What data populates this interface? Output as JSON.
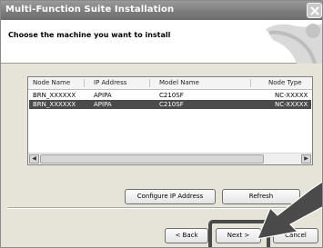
{
  "window": {
    "title": "Multi-Function Suite Installation"
  },
  "header": {
    "instruction": "Choose the machine you want to install"
  },
  "table": {
    "columns": [
      "Node Name",
      "IP Address",
      "Model Name",
      "Node Type"
    ],
    "rows": [
      {
        "node_name": "BRN_XXXXXX",
        "ip_address": "APIPA",
        "model_name": "C210SF",
        "node_type": "NC-XXXXX",
        "selected": false
      },
      {
        "node_name": "BRN_XXXXXX",
        "ip_address": "APIPA",
        "model_name": "C210SF",
        "node_type": "NC-XXXXX",
        "selected": true
      }
    ]
  },
  "buttons": {
    "configure_ip": "Configure IP Address",
    "refresh": "Refresh",
    "back": "< Back",
    "next": "Next >",
    "cancel": "Cancel"
  },
  "icons": {
    "close": "close-icon",
    "scroll_left": "scroll-left-icon",
    "scroll_right": "scroll-right-icon",
    "pointer_arrow": "pointer-arrow-icon"
  },
  "colors": {
    "selection": "#4b4b4b",
    "titlebar": "#7d7d7d"
  }
}
